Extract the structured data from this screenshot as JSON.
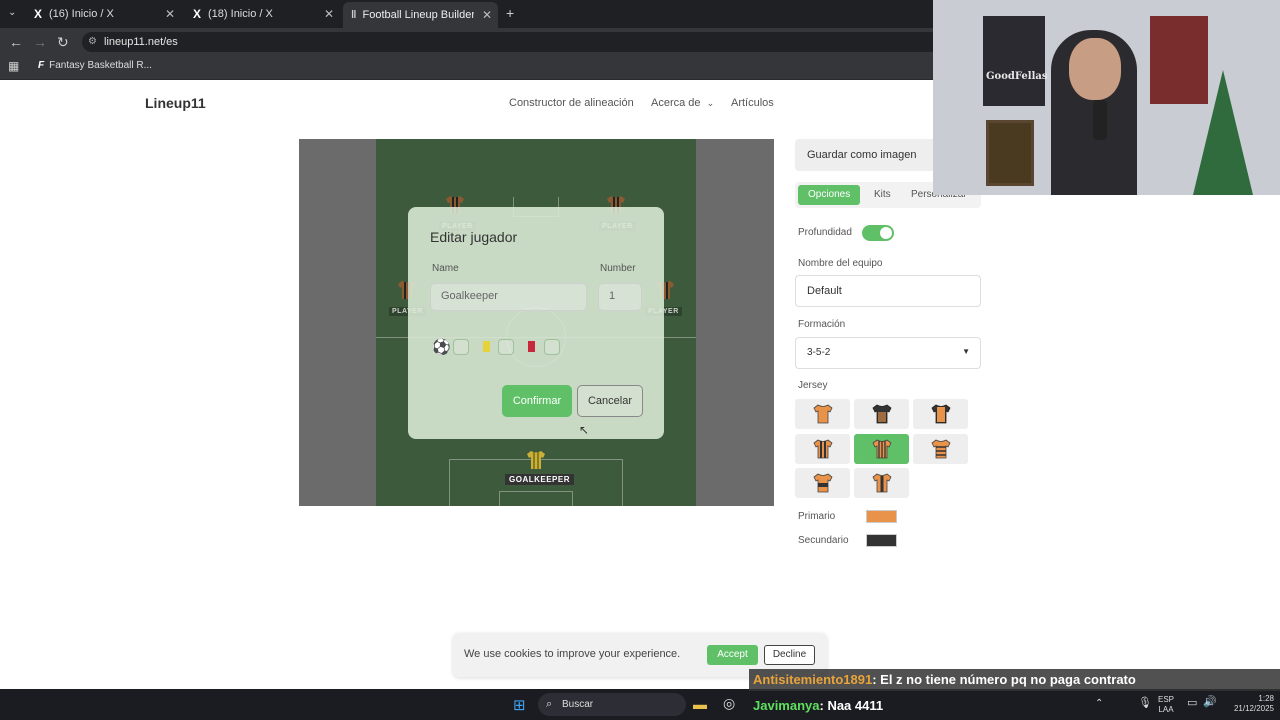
{
  "browser": {
    "tabs": [
      {
        "label": "(16) Inicio / X"
      },
      {
        "label": "(18) Inicio / X"
      },
      {
        "label": "Football Lineup Builder - Creat"
      }
    ],
    "url": "lineup11.net/es",
    "bookmark": "Fantasy Basketball R..."
  },
  "site": {
    "logo": "Lineup11",
    "nav": [
      "Constructor de alineación",
      "Acerca de",
      "Artículos"
    ]
  },
  "pitch": {
    "player_label": "PLAYER",
    "goalkeeper_label": "GOALKEEPER"
  },
  "modal": {
    "title": "Editar jugador",
    "name_label": "Name",
    "name_value": "Goalkeeper",
    "number_label": "Number",
    "number_value": "1",
    "confirm": "Confirmar",
    "cancel": "Cancelar"
  },
  "panel": {
    "save": "Guardar como imagen",
    "tabs": [
      "Opciones",
      "Kits",
      "Personalizar"
    ],
    "depth_label": "Profundidad",
    "team_name_label": "Nombre del equipo",
    "team_name_value": "Default",
    "formation_label": "Formación",
    "formation_value": "3-5-2",
    "jersey_label": "Jersey",
    "primary_label": "Primario",
    "secondary_label": "Secundario",
    "colors": {
      "primary": "#e8924a",
      "secondary": "#333333",
      "accent": "#5fc068"
    }
  },
  "cookie": {
    "text": "We use cookies to improve your experience.",
    "accept": "Accept",
    "decline": "Decline"
  },
  "taskbar": {
    "search": "Buscar",
    "lang_top": "ESP",
    "lang_bottom": "LAA",
    "time": "1:28",
    "date": "21/12/2025"
  },
  "chat": [
    {
      "user": "Antisitemiento1891",
      "message": ": El z no tiene número pq no paga contrato"
    },
    {
      "user": "Javimanya",
      "message": ": Naa 4411"
    }
  ]
}
